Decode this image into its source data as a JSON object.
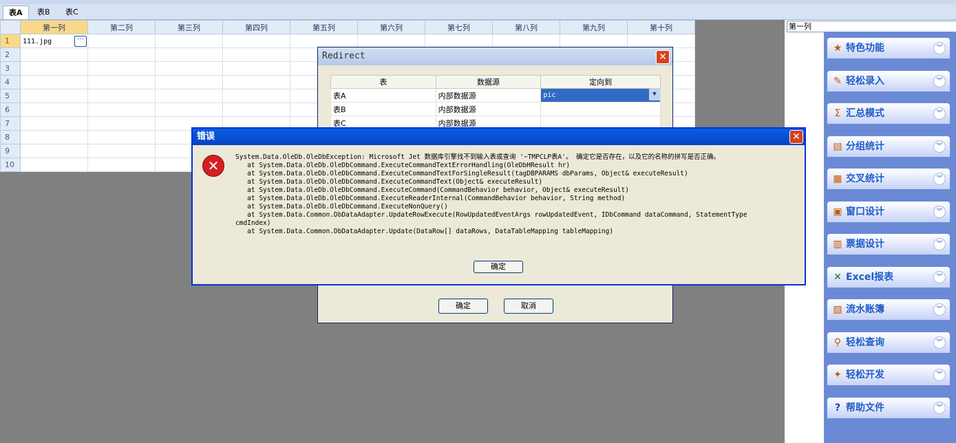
{
  "sheet_tabs": [
    "表A",
    "表B",
    "表C"
  ],
  "grid": {
    "columns": [
      "第一列",
      "第二列",
      "第三列",
      "第四列",
      "第五列",
      "第六列",
      "第七列",
      "第八列",
      "第九列",
      "第十列"
    ],
    "rows": [
      "1",
      "2",
      "3",
      "4",
      "5",
      "6",
      "7",
      "8",
      "9",
      "10"
    ],
    "cell_value": "111.jpg",
    "dots_label": "···"
  },
  "column_name_box": "第一列",
  "task_pane": [
    {
      "label": "特色功能",
      "icon": "feature-icon",
      "glyph": "★"
    },
    {
      "label": "轻松录入",
      "icon": "entry-icon",
      "glyph": "✎"
    },
    {
      "label": "汇总模式",
      "icon": "sigma-icon",
      "glyph": "Σ"
    },
    {
      "label": "分组统计",
      "icon": "group-stats-icon",
      "glyph": "▤"
    },
    {
      "label": "交叉统计",
      "icon": "cross-stats-icon",
      "glyph": "▦"
    },
    {
      "label": "窗口设计",
      "icon": "window-design-icon",
      "glyph": "▣"
    },
    {
      "label": "票据设计",
      "icon": "receipt-design-icon",
      "glyph": "▥"
    },
    {
      "label": "Excel报表",
      "icon": "excel-icon",
      "glyph": "✕"
    },
    {
      "label": "流水账簿",
      "icon": "ledger-icon",
      "glyph": "▧"
    },
    {
      "label": "轻松查询",
      "icon": "query-icon",
      "glyph": "⚲"
    },
    {
      "label": "轻松开发",
      "icon": "develop-icon",
      "glyph": "✦"
    },
    {
      "label": "帮助文件",
      "icon": "help-icon",
      "glyph": "?"
    }
  ],
  "chevron": "︾",
  "redirect_dialog": {
    "title": "Redirect",
    "close_glyph": "✕",
    "headers": [
      "表",
      "数据源",
      "定向到"
    ],
    "rows": [
      {
        "table": "表A",
        "source": "内部数据源",
        "target": "pic"
      },
      {
        "table": "表B",
        "source": "内部数据源",
        "target": ""
      },
      {
        "table": "表C",
        "source": "内部数据源",
        "target": ""
      }
    ],
    "ok": "确定",
    "cancel": "取消",
    "dropdown_glyph": "▼"
  },
  "error_dialog": {
    "title": "错误",
    "close_glyph": "✕",
    "icon_glyph": "✕",
    "message": "System.Data.OleDb.OleDbException: Microsoft Jet 数据库引擎找不到输入表或查询 '~TMPCLP表A'。 确定它是否存在，以及它的名称的拼写是否正确。\n   at System.Data.OleDb.OleDbCommand.ExecuteCommandTextErrorHandling(OleDbHResult hr)\n   at System.Data.OleDb.OleDbCommand.ExecuteCommandTextForSingleResult(tagDBPARAMS dbParams, Object& executeResult)\n   at System.Data.OleDb.OleDbCommand.ExecuteCommandText(Object& executeResult)\n   at System.Data.OleDb.OleDbCommand.ExecuteCommand(CommandBehavior behavior, Object& executeResult)\n   at System.Data.OleDb.OleDbCommand.ExecuteReaderInternal(CommandBehavior behavior, String method)\n   at System.Data.OleDb.OleDbCommand.ExecuteNonQuery()\n   at System.Data.Common.DbDataAdapter.UpdateRowExecute(RowUpdatedEventArgs rowUpdatedEvent, IDbCommand dataCommand, StatementType\ncmdIndex)\n   at System.Data.Common.DbDataAdapter.Update(DataRow[] dataRows, DataTableMapping tableMapping)",
    "ok": "确定"
  }
}
